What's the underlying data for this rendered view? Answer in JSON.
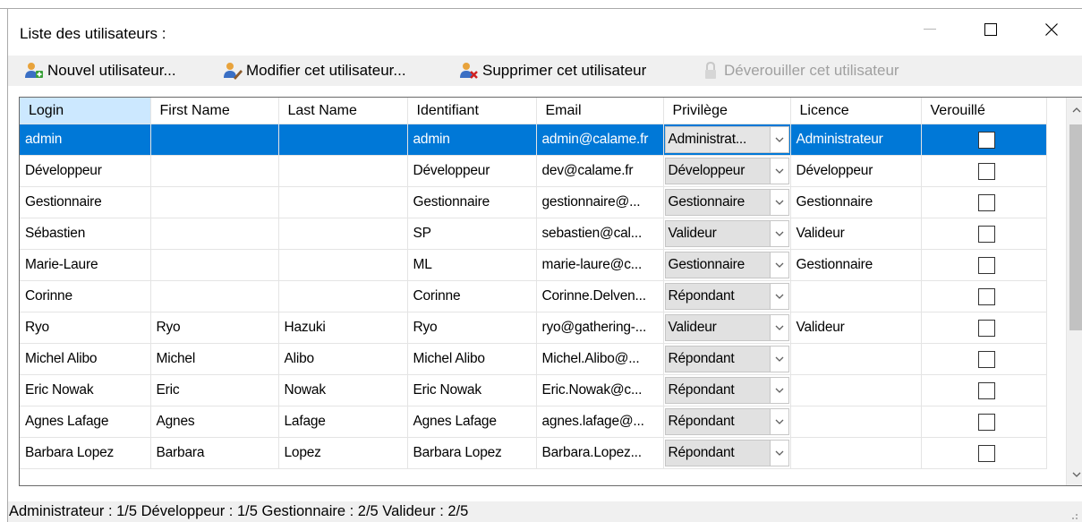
{
  "window": {
    "title": "Liste des utilisateurs :"
  },
  "toolbar": {
    "new_user": "Nouvel utilisateur...",
    "edit_user": "Modifier cet utilisateur...",
    "delete_user": "Supprimer cet utilisateur",
    "unlock_user": "Déverouiller cet utilisateur"
  },
  "grid": {
    "columns": [
      "Login",
      "First Name",
      "Last Name",
      "Identifiant",
      "Email",
      "Privilège",
      "Licence",
      "Verouillé"
    ],
    "rows": [
      {
        "login": "admin",
        "first": "",
        "last": "",
        "id": "admin",
        "email": "admin@calame.fr",
        "priv": "Administrat...",
        "licence": "Administrateur",
        "locked": false
      },
      {
        "login": "Développeur",
        "first": "",
        "last": "",
        "id": "Développeur",
        "email": "dev@calame.fr",
        "priv": "Développeur",
        "licence": "Développeur",
        "locked": false
      },
      {
        "login": "Gestionnaire",
        "first": "",
        "last": "",
        "id": "Gestionnaire",
        "email": "gestionnaire@...",
        "priv": "Gestionnaire",
        "licence": "Gestionnaire",
        "locked": false
      },
      {
        "login": "Sébastien",
        "first": "",
        "last": "",
        "id": "SP",
        "email": "sebastien@cal...",
        "priv": "Valideur",
        "licence": "Valideur",
        "locked": false
      },
      {
        "login": "Marie-Laure",
        "first": "",
        "last": "",
        "id": "ML",
        "email": "marie-laure@c...",
        "priv": "Gestionnaire",
        "licence": "Gestionnaire",
        "locked": false
      },
      {
        "login": "Corinne",
        "first": "",
        "last": "",
        "id": "Corinne",
        "email": "Corinne.Delven...",
        "priv": "Répondant",
        "licence": "",
        "locked": false
      },
      {
        "login": "Ryo",
        "first": "Ryo",
        "last": "Hazuki",
        "id": "Ryo",
        "email": "ryo@gathering-...",
        "priv": "Valideur",
        "licence": "Valideur",
        "locked": false
      },
      {
        "login": "Michel Alibo",
        "first": "Michel",
        "last": "Alibo",
        "id": "Michel Alibo",
        "email": "Michel.Alibo@...",
        "priv": "Répondant",
        "licence": "",
        "locked": false
      },
      {
        "login": "Eric Nowak",
        "first": "Eric",
        "last": "Nowak",
        "id": "Eric Nowak",
        "email": "Eric.Nowak@c...",
        "priv": "Répondant",
        "licence": "",
        "locked": false
      },
      {
        "login": "Agnes Lafage",
        "first": "Agnes",
        "last": "Lafage",
        "id": "Agnes Lafage",
        "email": "agnes.lafage@...",
        "priv": "Répondant",
        "licence": "",
        "locked": false
      },
      {
        "login": "Barbara Lopez",
        "first": "Barbara",
        "last": "Lopez",
        "id": "Barbara Lopez",
        "email": "Barbara.Lopez...",
        "priv": "Répondant",
        "licence": "",
        "locked": false
      }
    ]
  },
  "status": {
    "text": "Administrateur : 1/5   Développeur : 1/5   Gestionnaire : 2/5   Valideur : 2/5"
  },
  "colors": {
    "selection": "#0078d7",
    "header_selected": "#cce8ff"
  }
}
